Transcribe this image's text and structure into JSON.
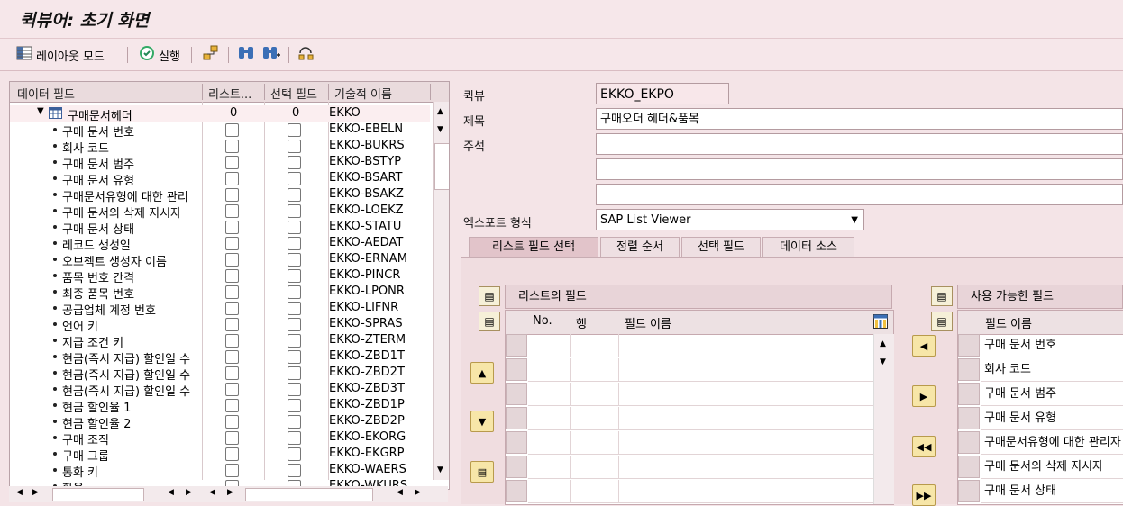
{
  "window": {
    "title": "퀵뷰어: 초기 화면"
  },
  "toolbar": {
    "layout_mode": "레이아웃 모드",
    "execute": "실행"
  },
  "tree": {
    "columns": [
      "데이터 필드",
      "리스트...",
      "선택 필드",
      "기술적 이름"
    ],
    "root": {
      "label": "구매문서헤더",
      "list_count": "0",
      "select_count": "0",
      "tech": "EKKO"
    },
    "items": [
      {
        "label": "구매 문서 번호",
        "tech": "EKKO-EBELN"
      },
      {
        "label": "회사 코드",
        "tech": "EKKO-BUKRS"
      },
      {
        "label": "구매 문서 범주",
        "tech": "EKKO-BSTYP"
      },
      {
        "label": "구매 문서 유형",
        "tech": "EKKO-BSART"
      },
      {
        "label": "구매문서유형에 대한 관리",
        "tech": "EKKO-BSAKZ"
      },
      {
        "label": "구매 문서의 삭제 지시자",
        "tech": "EKKO-LOEKZ"
      },
      {
        "label": "구매 문서 상태",
        "tech": "EKKO-STATU"
      },
      {
        "label": "레코드 생성일",
        "tech": "EKKO-AEDAT"
      },
      {
        "label": "오브젝트 생성자 이름",
        "tech": "EKKO-ERNAM"
      },
      {
        "label": "품목 번호 간격",
        "tech": "EKKO-PINCR"
      },
      {
        "label": "최종 품목 번호",
        "tech": "EKKO-LPONR"
      },
      {
        "label": "공급업체 계정 번호",
        "tech": "EKKO-LIFNR"
      },
      {
        "label": "언어 키",
        "tech": "EKKO-SPRAS"
      },
      {
        "label": "지급 조건 키",
        "tech": "EKKO-ZTERM"
      },
      {
        "label": "현금(즉시 지급) 할인일 수",
        "tech": "EKKO-ZBD1T"
      },
      {
        "label": "현금(즉시 지급) 할인일 수",
        "tech": "EKKO-ZBD2T"
      },
      {
        "label": "현금(즉시 지급) 할인일 수",
        "tech": "EKKO-ZBD3T"
      },
      {
        "label": "현금 할인율 1",
        "tech": "EKKO-ZBD1P"
      },
      {
        "label": "현금 할인율 2",
        "tech": "EKKO-ZBD2P"
      },
      {
        "label": "구매 조직",
        "tech": "EKKO-EKORG"
      },
      {
        "label": "구매 그룹",
        "tech": "EKKO-EKGRP"
      },
      {
        "label": "통화 키",
        "tech": "EKKO-WAERS"
      },
      {
        "label": "환율",
        "tech": "EKKO-WKURS"
      }
    ]
  },
  "form": {
    "quickview_label": "퀵뷰",
    "quickview_value": "EKKO_EKPO",
    "title_label": "제목",
    "title_value": "구매오더 헤더&품목",
    "comment_label": "주석",
    "export_label": "엑스포트 형식",
    "export_value": "SAP List Viewer"
  },
  "tabs": [
    "리스트 필드 선택",
    "정렬 순서",
    "선택 필드",
    "데이터 소스"
  ],
  "list_fields": {
    "title": "리스트의 필드",
    "columns": [
      "No.",
      "행",
      "필드 이름"
    ]
  },
  "available_fields": {
    "title": "사용 가능한 필드",
    "column": "필드 이름",
    "items": [
      "구매 문서 번호",
      "회사 코드",
      "구매 문서 범주",
      "구매 문서 유형",
      "구매문서유형에 대한 관리자",
      "구매 문서의 삭제 지시자",
      "구매 문서 상태"
    ]
  }
}
